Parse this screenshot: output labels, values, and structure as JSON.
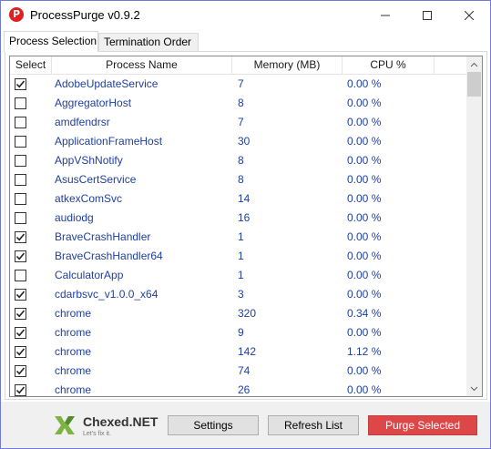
{
  "window": {
    "title": "ProcessPurge v0.9.2",
    "app_icon_letter": "P",
    "colors": {
      "accent_border": "#6f7bd6",
      "link_text": "#1f3fa0",
      "purge": "#dd4747"
    }
  },
  "tabs": [
    {
      "label": "Process Selection",
      "active": true
    },
    {
      "label": "Termination Order",
      "active": false
    }
  ],
  "table": {
    "columns": [
      "Select",
      "Process Name",
      "Memory (MB)",
      "CPU %"
    ],
    "rows": [
      {
        "checked": true,
        "name": "AdobeUpdateService",
        "memory": "7",
        "cpu": "0.00 %"
      },
      {
        "checked": false,
        "name": "AggregatorHost",
        "memory": "8",
        "cpu": "0.00 %"
      },
      {
        "checked": false,
        "name": "amdfendrsr",
        "memory": "7",
        "cpu": "0.00 %"
      },
      {
        "checked": false,
        "name": "ApplicationFrameHost",
        "memory": "30",
        "cpu": "0.00 %"
      },
      {
        "checked": false,
        "name": "AppVShNotify",
        "memory": "8",
        "cpu": "0.00 %"
      },
      {
        "checked": false,
        "name": "AsusCertService",
        "memory": "8",
        "cpu": "0.00 %"
      },
      {
        "checked": false,
        "name": "atkexComSvc",
        "memory": "14",
        "cpu": "0.00 %"
      },
      {
        "checked": false,
        "name": "audiodg",
        "memory": "16",
        "cpu": "0.00 %"
      },
      {
        "checked": true,
        "name": "BraveCrashHandler",
        "memory": "1",
        "cpu": "0.00 %"
      },
      {
        "checked": true,
        "name": "BraveCrashHandler64",
        "memory": "1",
        "cpu": "0.00 %"
      },
      {
        "checked": false,
        "name": "CalculatorApp",
        "memory": "1",
        "cpu": "0.00 %"
      },
      {
        "checked": true,
        "name": "cdarbsvc_v1.0.0_x64",
        "memory": "3",
        "cpu": "0.00 %"
      },
      {
        "checked": true,
        "name": "chrome",
        "memory": "320",
        "cpu": "0.34 %"
      },
      {
        "checked": true,
        "name": "chrome",
        "memory": "9",
        "cpu": "0.00 %"
      },
      {
        "checked": true,
        "name": "chrome",
        "memory": "142",
        "cpu": "1.12 %"
      },
      {
        "checked": true,
        "name": "chrome",
        "memory": "74",
        "cpu": "0.00 %"
      },
      {
        "checked": true,
        "name": "chrome",
        "memory": "26",
        "cpu": "0.00 %"
      }
    ]
  },
  "footer": {
    "logo_text": "Chexed.NET",
    "logo_tagline": "Let's fix it.",
    "settings_label": "Settings",
    "refresh_label": "Refresh List",
    "purge_label": "Purge Selected"
  }
}
